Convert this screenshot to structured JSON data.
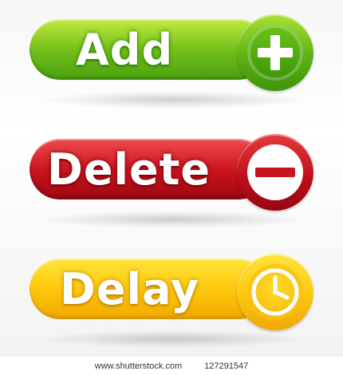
{
  "buttons": [
    {
      "id": "add",
      "label": "Add",
      "icon": "plus-icon",
      "color": "#6cbc1b"
    },
    {
      "id": "delete",
      "label": "Delete",
      "icon": "minus-icon",
      "color": "#c8141d"
    },
    {
      "id": "delay",
      "label": "Delay",
      "icon": "clock-icon",
      "color": "#fdc30c"
    }
  ],
  "footer": {
    "site": "www.shutterstock.com",
    "image_number": "127291547"
  }
}
